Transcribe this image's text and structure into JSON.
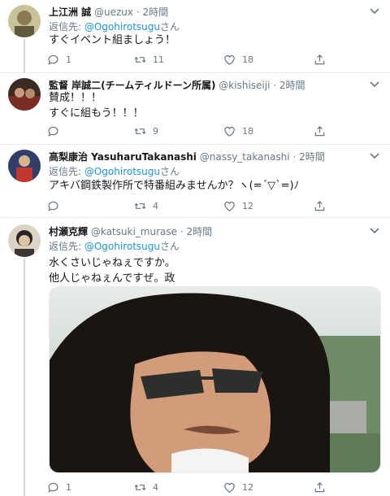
{
  "tweets": [
    {
      "name": "上江洲 誠",
      "handle": "@uezux",
      "time": "2時間",
      "reply_prefix": "返信先: ",
      "reply_handle": "@Ogohirotsugu",
      "reply_suffix": "さん",
      "lines": [
        "すぐイベント組ましょう！"
      ],
      "replies": "1",
      "retweets": "11",
      "likes": "18"
    },
    {
      "name": "監督 岸誠二(チームティルドーン所属)",
      "handle": "@kishiseiji",
      "time": "2時間",
      "lines": [
        "賛成！！！",
        "すぐに組もう！！！"
      ],
      "replies": "",
      "retweets": "9",
      "likes": "18"
    },
    {
      "name": "高梨康治 YasuharuTakanashi",
      "handle": "@nassy_takanashi",
      "time": "2時間",
      "reply_prefix": "返信先: ",
      "reply_handle": "@Ogohirotsugu",
      "reply_suffix": "さん",
      "lines": [
        "アキバ鋼鉄製作所で特番組みませんか？ヽ(=´▽`=)ﾉ"
      ],
      "replies": "",
      "retweets": "4",
      "likes": "12"
    },
    {
      "name": "村瀬克輝",
      "handle": "@katsuki_murase",
      "time": "2時間",
      "reply_prefix": "返信先: ",
      "reply_handle": "@Ogohirotsugu",
      "reply_suffix": "さん",
      "lines": [
        "水くさいじゃねぇですか。",
        "他人じゃねぇんですぜ。政"
      ],
      "replies": "1",
      "retweets": "4",
      "likes": "12"
    }
  ],
  "icons": {
    "reply": "reply-icon",
    "retweet": "retweet-icon",
    "like": "heart-icon",
    "share": "share-icon",
    "more": "chevron-down-icon"
  },
  "colors": {
    "link": "#1b95e0",
    "secondary": "#657786",
    "divider": "#e6ecf0"
  }
}
